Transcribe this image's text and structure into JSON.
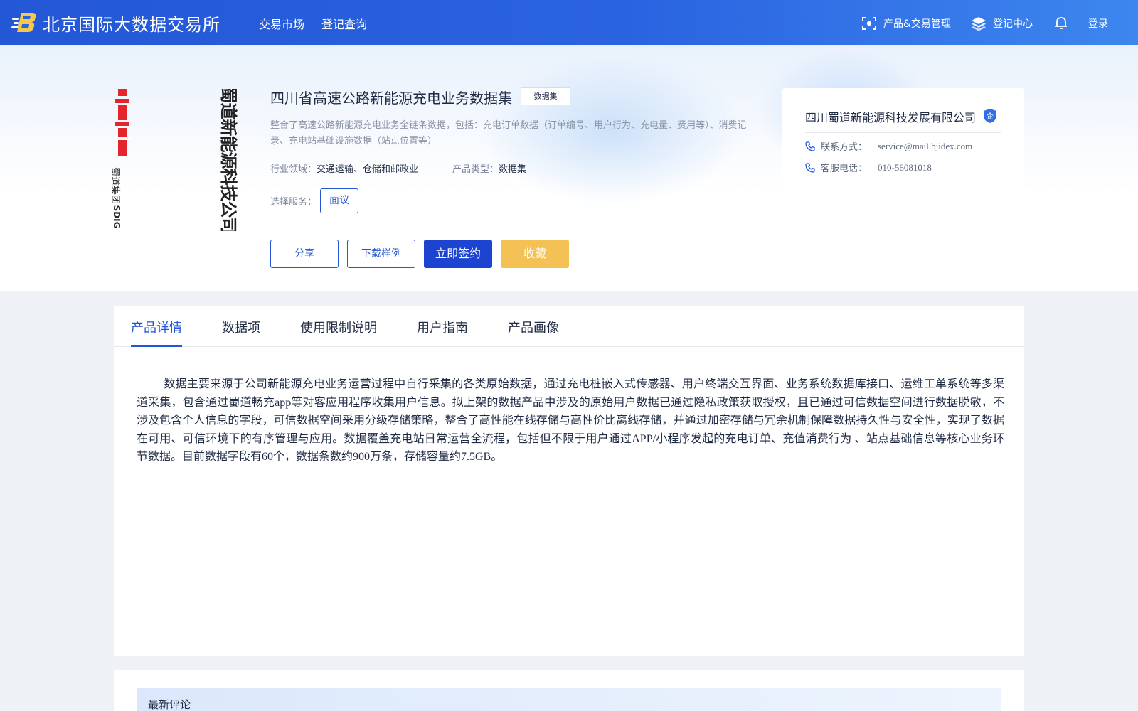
{
  "header": {
    "site_name": "北京国际大数据交易所",
    "nav": [
      "交易市场",
      "登记查询"
    ],
    "product_mgmt": "产品&交易管理",
    "register_center": "登记中心",
    "login": "登录"
  },
  "product": {
    "title": "四川省高速公路新能源充电业务数据集",
    "tag": "数据集",
    "description": "整合了高速公路新能源充电业务全链条数据，包括：充电订单数据（订单编号、用户行为、充电量、费用等）、消费记录、充电站基础设施数据（站点位置等）",
    "industry_label": "行业领域：",
    "industry_value": "交通运输、仓储和邮政业",
    "type_label": "产品类型：",
    "type_value": "数据集",
    "service_label": "选择服务：",
    "service_option": "面议",
    "buttons": {
      "share": "分享",
      "download_sample": "下载样例",
      "sign_now": "立即签约",
      "favorite": "收藏"
    }
  },
  "seller": {
    "name": "四川蜀道新能源科技发展有限公司",
    "badge": "企",
    "contact_label": "联系方式：",
    "contact_value": "service@mail.bjidex.com",
    "phone_label": "客服电话：",
    "phone_value": "010-56081018"
  },
  "company_logo": {
    "main_text": "蜀道新能源科技公司",
    "sub_text": "蜀道集团",
    "abbr": "SDIG"
  },
  "tabs": [
    "产品详情",
    "数据项",
    "使用限制说明",
    "用户指南",
    "产品画像"
  ],
  "active_tab": "产品详情",
  "detail": "数据主要来源于公司新能源充电业务运营过程中自行采集的各类原始数据，通过充电桩嵌入式传感器、用户终端交互界面、业务系统数据库接口、运维工单系统等多渠道采集，包含通过蜀道畅充app等对客应用程序收集用户信息。拟上架的数据产品中涉及的原始用户数据已通过隐私政策获取授权，且已通过可信数据空间进行数据脱敏，不涉及包含个人信息的字段，可信数据空间采用分级存储策略，整合了高性能在线存储与高性价比离线存储，并通过加密存储与冗余机制保障数据持久性与安全性，实现了数据在可用、可信环境下的有序管理与应用。数据覆盖充电站日常运营全流程，包括但不限于用户通过APP/小程序发起的充电订单、充值消费行为 、站点基础信息等核心业务环节数据。目前数据字段有60个，数据条数约900万条，存储容量约7.5GB。",
  "comments": {
    "title": "最新评论"
  },
  "colors": {
    "primary": "#2356d4",
    "gold": "#f3c154",
    "logo_red": "#e4252b"
  }
}
